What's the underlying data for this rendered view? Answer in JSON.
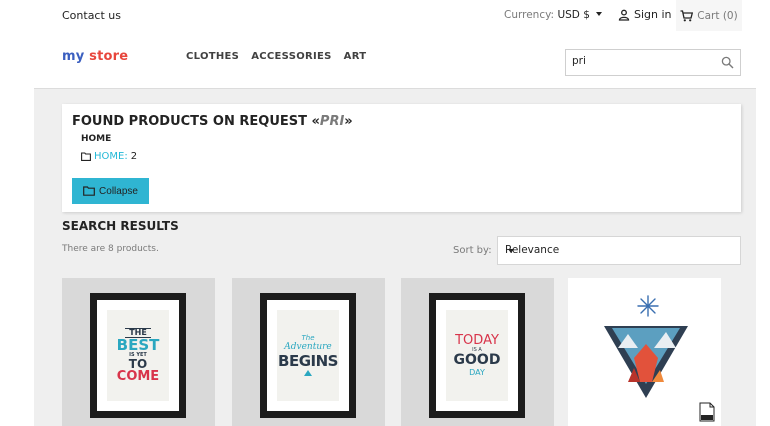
{
  "topbar": {
    "contact": "Contact us",
    "currency_label": "Currency:",
    "currency_value": "USD $",
    "signin": "Sign in",
    "cart": "Cart (0)"
  },
  "header": {
    "logo_part1": "my",
    "logo_part2": "store",
    "nav": [
      "CLOTHES",
      "ACCESSORIES",
      "ART"
    ],
    "search_value": "pri"
  },
  "results_card": {
    "title_prefix": "FOUND PRODUCTS ON REQUEST «",
    "query": "PRI",
    "title_suffix": "»",
    "category": "HOME",
    "link_label": "HOME:",
    "link_count": "2",
    "collapse": "Collapse"
  },
  "search_results": {
    "title": "SEARCH RESULTS",
    "count_text": "There are 8 products.",
    "sort_label": "Sort by:",
    "sort_value": "Relevance"
  },
  "products": [
    {
      "lines": [
        "THE",
        "BEST",
        "IS YET",
        "TO",
        "COME"
      ]
    },
    {
      "lines": [
        "The",
        "Adventure",
        "BEGINS"
      ]
    },
    {
      "lines": [
        "TODAY",
        "IS A",
        "GOOD",
        "DAY"
      ]
    },
    {
      "lines": []
    }
  ],
  "colors": {
    "accent": "#2fb5d2",
    "link": "#24b9d7",
    "background": "#efefef"
  }
}
